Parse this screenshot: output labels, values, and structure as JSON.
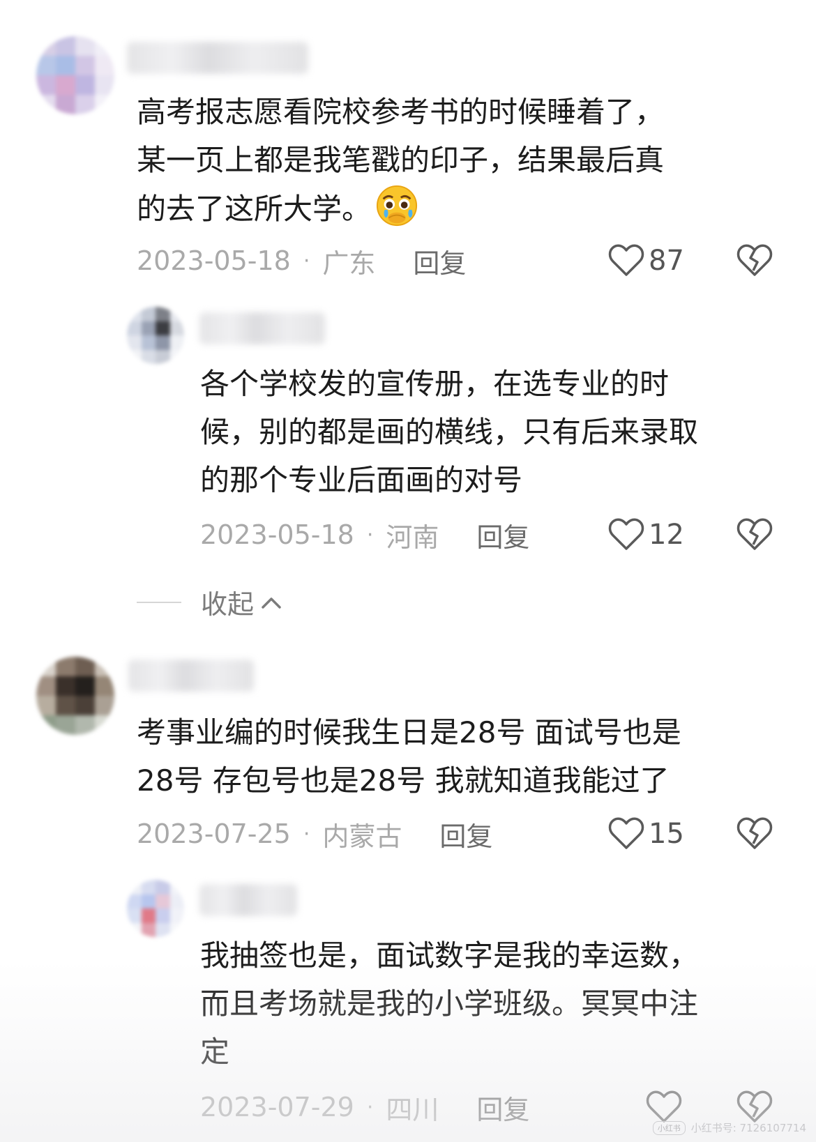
{
  "comments": [
    {
      "lines": [
        "高考报志愿看院校参考书的时候睡着了，",
        "某一页上都是我笔戳的印子，结果最后真",
        "的去了这所大学。"
      ],
      "emoji": "crying-face-covering-mouth-emoji",
      "date": "2023-05-18",
      "region": "广东",
      "reply": "回复",
      "likes": "87"
    },
    {
      "lines": [
        "各个学校发的宣传册，在选专业的时",
        "候，别的都是画的横线，只有后来录取",
        "的那个专业后面画的对号"
      ],
      "date": "2023-05-18",
      "region": "河南",
      "reply": "回复",
      "likes": "12"
    },
    {
      "lines": [
        "考事业编的时候我生日是28号 面试号也是",
        "28号 存包号也是28号 我就知道我能过了"
      ],
      "date": "2023-07-25",
      "region": "内蒙古",
      "reply": "回复",
      "likes": "15"
    },
    {
      "lines": [
        "我抽签也是，面试数字是我的幸运数，",
        "而且考场就是我的小学班级。冥冥中注",
        "定"
      ],
      "date": "2023-07-29",
      "region": "四川",
      "reply": "回复",
      "likes": ""
    }
  ],
  "collapse_label": "收起",
  "dot": "·",
  "watermark": {
    "logo": "小红书",
    "text": "小红书号: 7126107714"
  },
  "colors": {
    "heart": "#5a5a5a",
    "meta_text": "#a9a9a9"
  }
}
